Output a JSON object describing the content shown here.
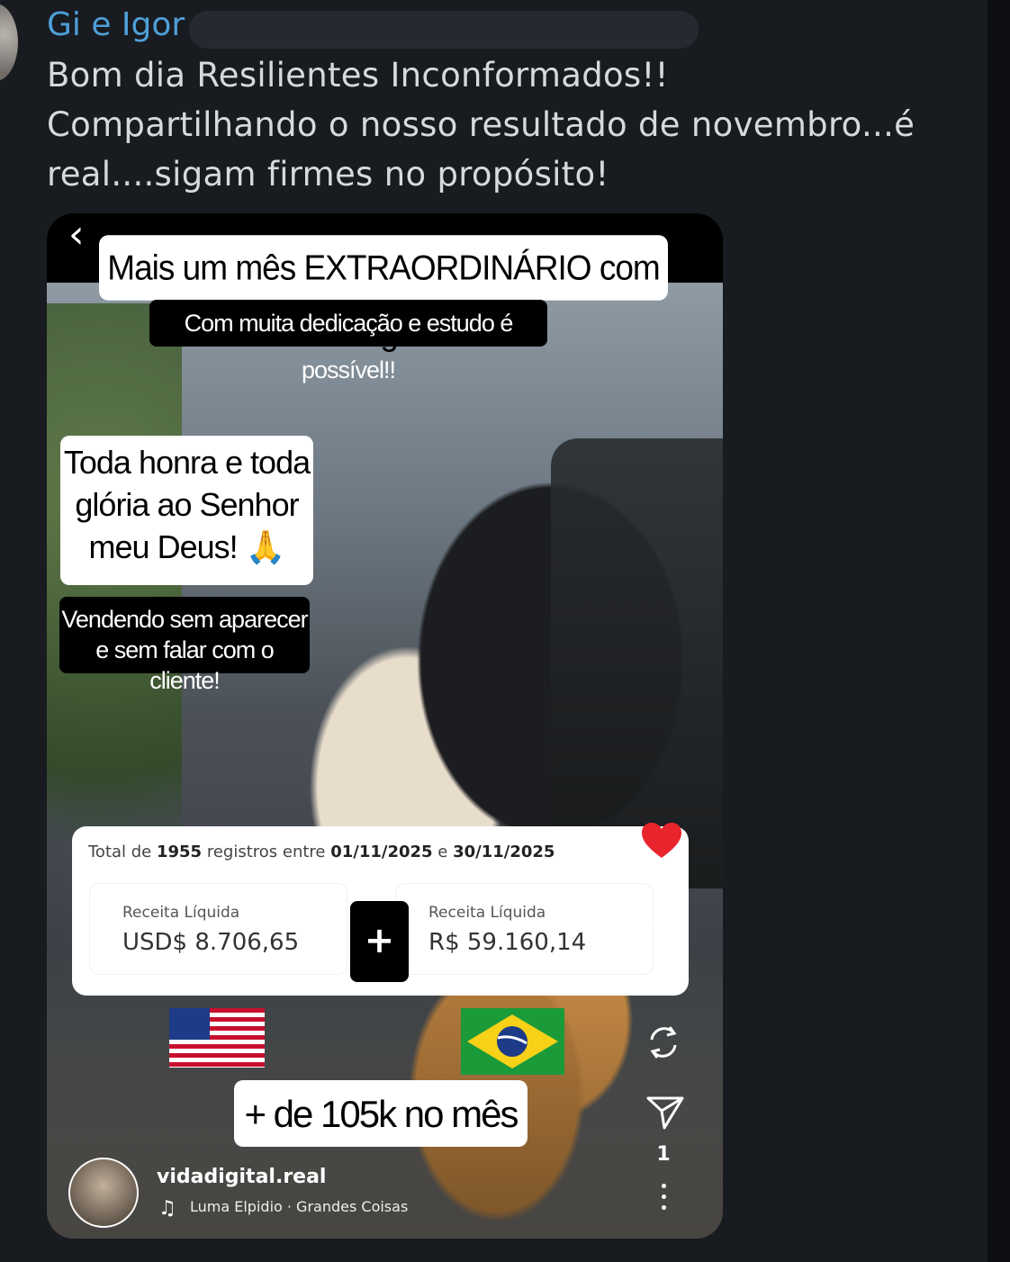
{
  "chat": {
    "sender": "Gi e Igor",
    "message_lines": [
      "Bom dia Resilientes Inconformados!!",
      "Compartilhando o nosso resultado de novembro...é",
      "real....sigam firmes no propósito!"
    ]
  },
  "post": {
    "caption_main": "Mais um mês EXTRAORDINÁRIO com o digital",
    "caption_sub": "Com muita dedicação e estudo é possível!!",
    "caption_faith_lines": [
      "Toda honra e toda",
      "glória ao Senhor",
      "meu Deus! 🙏"
    ],
    "caption_sales_lines": [
      "Vendendo sem aparecer",
      "e sem falar com o cliente!"
    ],
    "card": {
      "total_prefix": "Total de ",
      "total_count": "1955",
      "total_mid": " registros entre ",
      "date_start": "01/11/2025",
      "date_join": " e ",
      "date_end": "30/11/2025",
      "left_label": "Receita Líquida",
      "left_value": "USD$ 8.706,65",
      "right_label": "Receita Líquida",
      "right_value": "R$ 59.160,14",
      "plus_symbol": "+"
    },
    "total_caption": "+ de 105k no mês",
    "owner": "vidadigital.real",
    "music": "Luma Elpidio · Grandes Coisas",
    "share_count": "1",
    "icons": [
      "back-chevron-icon",
      "heart-icon",
      "comment-icon",
      "repost-icon",
      "share-icon",
      "more-icon",
      "music-note-icon",
      "us-flag-icon",
      "brazil-flag-icon"
    ],
    "colors": {
      "heart": "#e8242c",
      "sender": "#4e9fd8"
    }
  }
}
